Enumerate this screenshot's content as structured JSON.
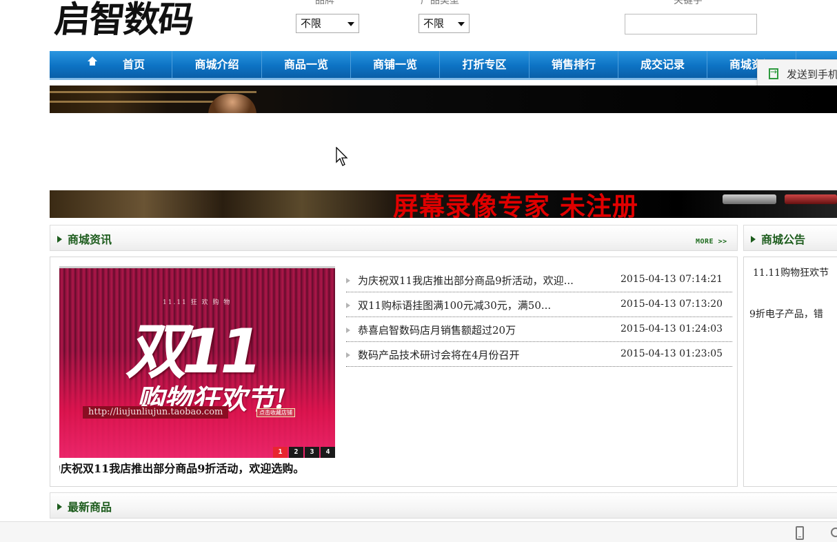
{
  "header": {
    "logo": "启智数码",
    "filters": {
      "brand": {
        "label": "品牌",
        "value": "不限"
      },
      "type": {
        "label": "产品类型",
        "value": "不限"
      },
      "keyword": {
        "label": "关键字",
        "value": ""
      }
    }
  },
  "nav": {
    "items": [
      "首页",
      "商城介绍",
      "商品一览",
      "商铺一览",
      "打折专区",
      "销售排行",
      "成交记录",
      "商城资讯"
    ]
  },
  "popup": {
    "send_to_phone": "发送到手机"
  },
  "watermark": "屏幕录像专家 未注册",
  "news_section": {
    "title": "商城资讯",
    "more": "MORE >>",
    "slideshow": {
      "sub_text": "11.11 狂 欢 购 物",
      "big_text": "双11",
      "slogan": "购物狂欢节!",
      "url": "http://liujunliujun.taobao.com",
      "fav_label": "点击收藏店铺",
      "pages": [
        "1",
        "2",
        "3",
        "4"
      ],
      "active_page": 1,
      "caption": "为庆祝双11我店推出部分商品9折活动，欢迎选购。"
    },
    "items": [
      {
        "title": "为庆祝双11我店推出部分商品9折活动，欢迎...",
        "date": "2015-04-13 07:14:21"
      },
      {
        "title": "双11购标语挂图满100元减30元，满50...",
        "date": "2015-04-13 07:13:20"
      },
      {
        "title": "恭喜启智数码店月销售额超过20万",
        "date": "2015-04-13 01:24:03"
      },
      {
        "title": "数码产品技术研讨会将在4月份召开",
        "date": "2015-04-13 01:23:05"
      }
    ]
  },
  "notice_section": {
    "title": "商城公告",
    "line1": "11.11购物狂欢节",
    "line2": "9折电子产品，错"
  },
  "latest_section": {
    "title": "最新商品"
  },
  "colors": {
    "nav_blue": "#0d73c4",
    "section_green": "#1d5c1d",
    "watermark_red": "#e00000"
  }
}
